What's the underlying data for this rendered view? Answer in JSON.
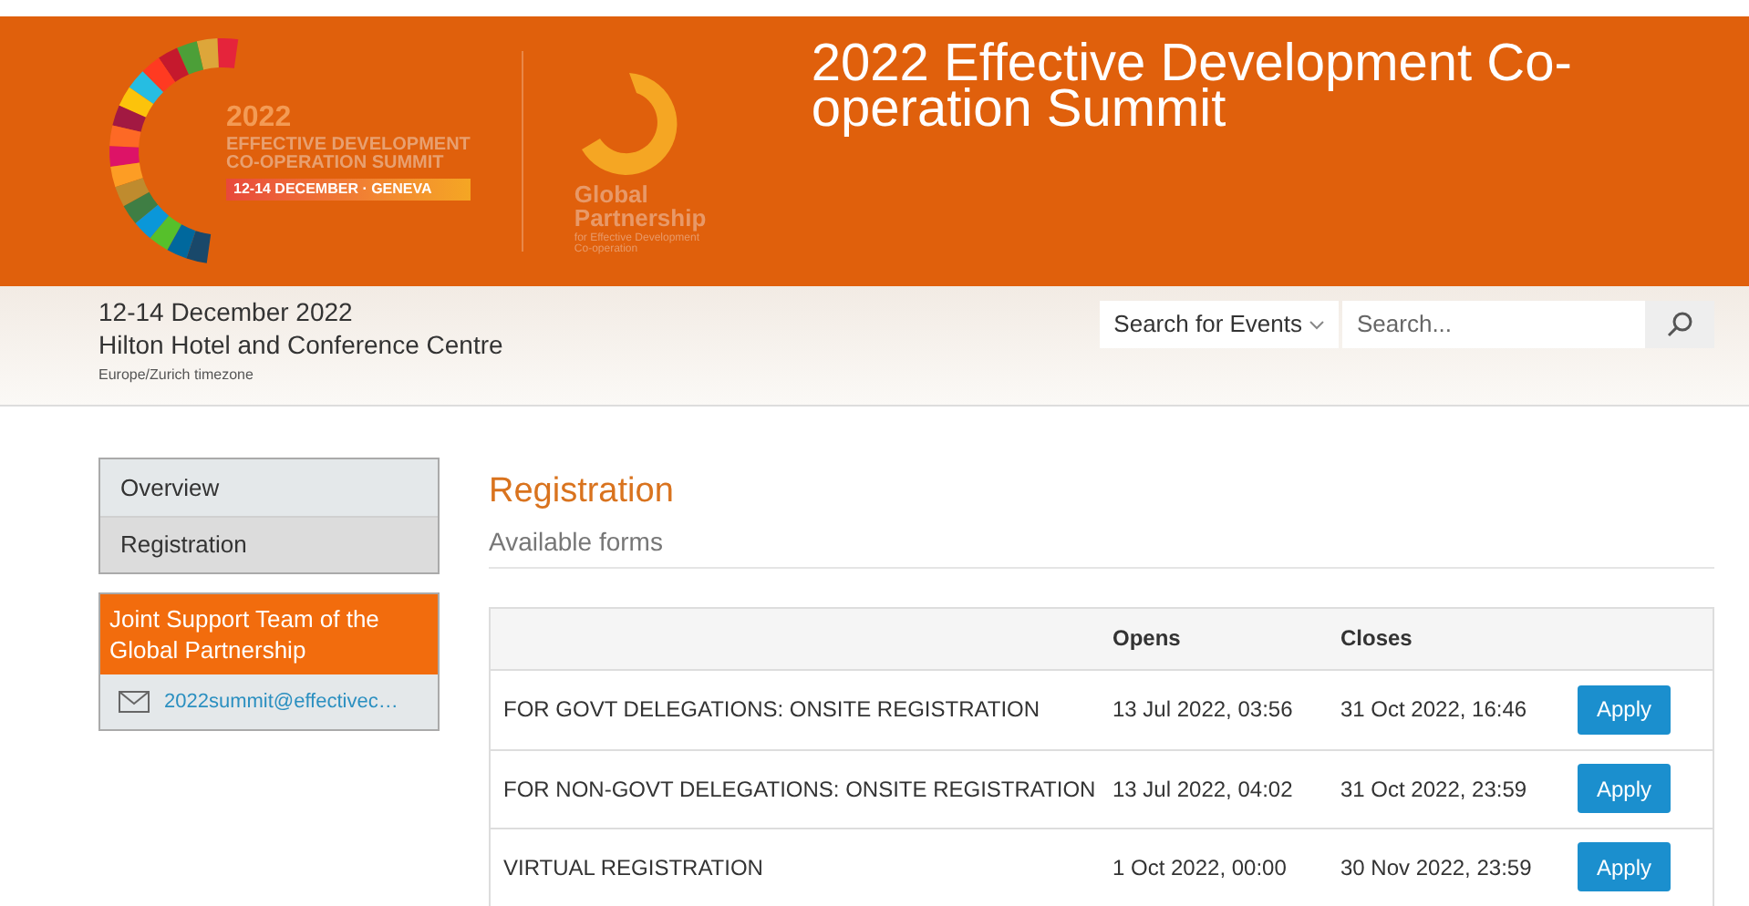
{
  "header": {
    "logo": {
      "year": "2022",
      "line_1": "EFFECTIVE DEVELOPMENT",
      "line_2": "CO-OPERATION SUMMIT",
      "dates": "12-14 DECEMBER · GENEVA"
    },
    "partner_logo": {
      "line_1": "Global",
      "line_2": "Partnership",
      "line_3": "for Effective Development",
      "line_4": "Co-operation"
    },
    "title": "2022 Effective Development Co-operation Summit"
  },
  "event_info": {
    "dates": "12-14 December 2022",
    "venue": "Hilton Hotel and Conference Centre",
    "timezone": "Europe/Zurich timezone"
  },
  "search": {
    "scope": "Search for Events",
    "placeholder": "Search..."
  },
  "menu": [
    {
      "label": "Overview",
      "selected": false
    },
    {
      "label": "Registration",
      "selected": true
    }
  ],
  "contact": {
    "title": "Joint Support Team of the Global Partnership",
    "email": "2022summit@effectivec…"
  },
  "page": {
    "title": "Registration",
    "subtitle": "Available forms"
  },
  "table": {
    "columns": [
      "Opens",
      "Closes"
    ],
    "rows": [
      {
        "name": "FOR GOVT DELEGATIONS: ONSITE REGISTRATION",
        "opens": "13 Jul 2022, 03:56",
        "closes": "31 Oct 2022, 16:46",
        "action": "Apply"
      },
      {
        "name": "FOR NON-GOVT DELEGATIONS: ONSITE REGISTRATION",
        "opens": "13 Jul 2022, 04:02",
        "closes": "31 Oct 2022, 23:59",
        "action": "Apply"
      },
      {
        "name": "VIRTUAL REGISTRATION",
        "opens": "1 Oct 2022, 00:00",
        "closes": "30 Nov 2022, 23:59",
        "action": "Apply"
      }
    ]
  }
}
